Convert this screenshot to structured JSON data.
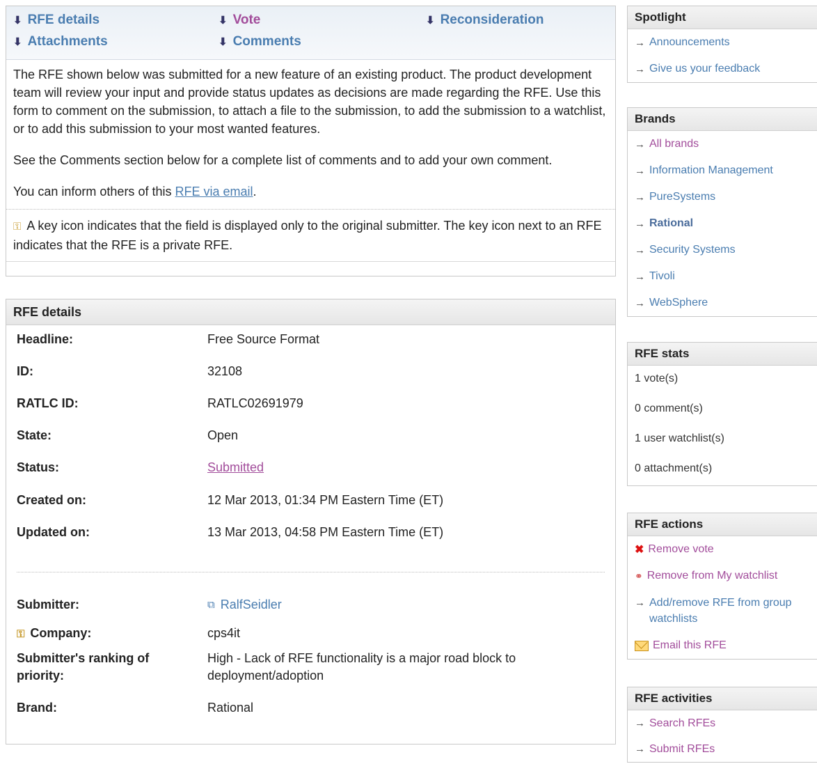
{
  "jump": {
    "rfe_details": "RFE details",
    "vote": "Vote",
    "reconsideration": "Reconsideration",
    "attachments": "Attachments",
    "comments": "Comments",
    "arrow": "⬇"
  },
  "intro": {
    "p1": "The RFE shown below was submitted for a new feature of an existing product. The product development team will review your input and provide status updates as decisions are made regarding the RFE. Use this form to comment on the submission, to attach a file to the submission, to add the submission to a watchlist, or to add this submission to your most wanted features.",
    "p2": "See the Comments section below for a complete list of comments and to add your own comment.",
    "p3_pre": "You can inform others of this ",
    "p3_link": "RFE via email",
    "p3_post": ".",
    "key_note": "A key icon indicates that the field is displayed only to the original submitter. The key icon next to an RFE indicates that the RFE is a private RFE."
  },
  "details": {
    "title": "RFE details",
    "rows": [
      {
        "label": "Headline:",
        "value": "Free Source Format"
      },
      {
        "label": "ID:",
        "value": "32108"
      },
      {
        "label": "RATLC ID:",
        "value": "RATLC02691979"
      },
      {
        "label": "State:",
        "value": "Open"
      },
      {
        "label": "Status:",
        "value": "Submitted"
      },
      {
        "label": "Created on:",
        "value": "12 Mar 2013, 01:34 PM Eastern Time (ET)"
      },
      {
        "label": "Updated on:",
        "value": "13 Mar 2013, 04:58 PM Eastern Time (ET)"
      },
      {
        "label": "Submitter:",
        "value": "RalfSeidler"
      },
      {
        "label": "Company:",
        "value": "cps4it"
      },
      {
        "label": "Submitter's ranking of priority:",
        "value": "High - Lack of RFE functionality is a major road block to deployment/adoption"
      },
      {
        "label": "Brand:",
        "value": "Rational"
      }
    ]
  },
  "spotlight": {
    "title": "Spotlight",
    "items": [
      "Announcements",
      "Give us your feedback"
    ]
  },
  "brands": {
    "title": "Brands",
    "items": [
      "All brands",
      "Information Management",
      "PureSystems",
      "Rational",
      "Security Systems",
      "Tivoli",
      "WebSphere"
    ]
  },
  "stats": {
    "title": "RFE stats",
    "items": [
      "1 vote(s)",
      "0 comment(s)",
      "1 user watchlist(s)",
      "0 attachment(s)"
    ]
  },
  "actions": {
    "title": "RFE actions",
    "items": [
      "Remove vote",
      "Remove from My watchlist",
      "Add/remove RFE from group watchlists",
      "Email this RFE"
    ]
  },
  "activities": {
    "title": "RFE activities",
    "items": [
      "Search RFEs",
      "Submit RFEs"
    ]
  },
  "colors": {
    "link": "#4a7db0",
    "visited": "#a24d9b",
    "header_bg": "#eaf0f6"
  }
}
